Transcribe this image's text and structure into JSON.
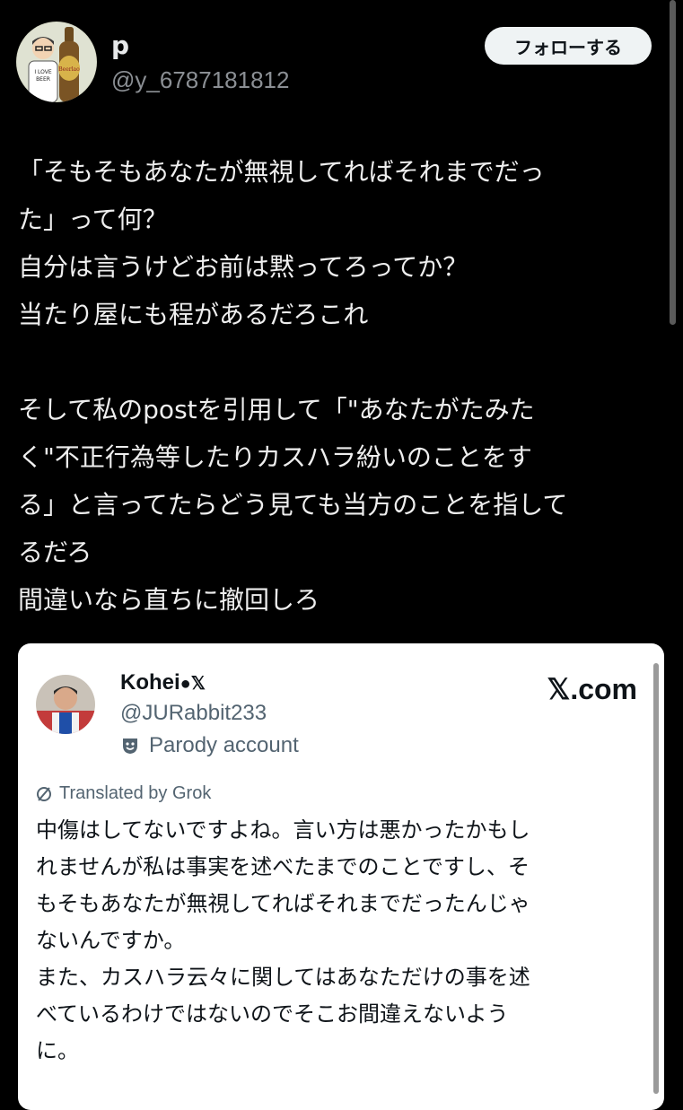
{
  "author": {
    "display_name": "p",
    "handle": "@y_6787181812",
    "avatar_icon": "beer-avatar-icon"
  },
  "follow_label": "フォローする",
  "post_lines": [
    "「そもそもあなたが無視してればそれまでだっ",
    "た」って何？",
    "自分は言うけどお前は黙ってろってか？",
    "当たり屋にも程があるだろこれ",
    "",
    "そして私のpostを引用して「\"あなたがたみた",
    "く\"不正行為等したりカスハラ紛いのことをす",
    "る」と言ってたらどう見ても当方のことを指して",
    "るだろ",
    "間違いなら直ちに撤回しろ"
  ],
  "quote": {
    "name": "Kohei",
    "name_icons": [
      "apple-icon",
      "x-logo-icon"
    ],
    "handle": "@JURabbit233",
    "parody_label": "Parody account",
    "site": "𝕏.com",
    "translated_label": "Translated by Grok",
    "lines": [
      "中傷はしてないですよね。言い方は悪かったかもし",
      "れませんが私は事実を述べたまでのことですし、そ",
      "もそもあなたが無視してればそれまでだったんじゃ",
      "ないんですか。",
      "また、カスハラ云々に関してはあなただけの事を述",
      "べているわけではないのでそこお間違えないよう",
      "に。"
    ]
  },
  "colors": {
    "background": "#000000",
    "text": "#e7e9ea",
    "muted": "#8b8f94",
    "card": "#ffffff"
  }
}
